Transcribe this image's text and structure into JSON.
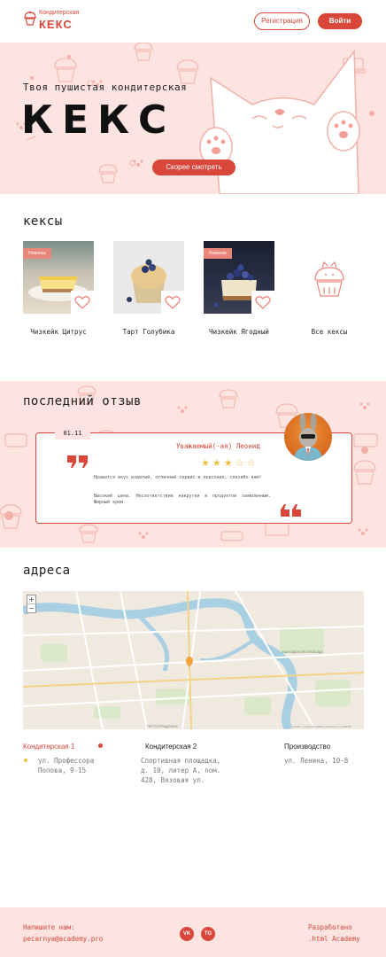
{
  "header": {
    "logo_small": "Кондитерская",
    "logo_big": "КЕКС",
    "register_label": "Регистрация",
    "login_label": "Войти"
  },
  "hero": {
    "subtitle": "Твоя пушистая кондитерская",
    "title": "КЕКС",
    "cta_label": "Скорее смотреть"
  },
  "cupcakes": {
    "title": "кексы",
    "items": [
      {
        "name": "Чизкейк Цитрус",
        "badge": "Новинка",
        "image": "lemon-cheesecake-slice"
      },
      {
        "name": "Тарт Голубика",
        "badge": "",
        "image": "blueberry-muffin"
      },
      {
        "name": "Чизкейк Ягодный",
        "badge": "Новинка",
        "image": "berry-cheesecake"
      }
    ],
    "all_label": "Все кексы"
  },
  "review": {
    "title": "последний отзыв",
    "date": "01.11",
    "author": "Уважаемый(-ая) Леонид",
    "rating": 3,
    "max_rating": 5,
    "paragraph_1": "Нравится вкус изделий, отличный сервис и персонал, спасибо вам!",
    "paragraph_2": "Высокий цена. Несоответствие накрутки и продуктов заявленным. Жирный крем."
  },
  "addresses": {
    "title": "адреса",
    "map_attribution": "Leaflet | © OpenStreetMap contributors © CARTO",
    "map_labels": {
      "district": "ВЫХОДСКОЙ СЛОБОДА",
      "street": "ПЕТРОГРАДСКАЯ"
    },
    "zoom_in": "+",
    "zoom_out": "−",
    "locations": [
      {
        "name": "Кондитерская 1",
        "address_line_1": "ул. Профессора",
        "address_line_2": "Попова, 9-15",
        "active": true
      },
      {
        "name": "Кондитерская 2",
        "address_line_1": "Спортивная площадка,",
        "address_line_2": "д. 10, литер А, пом.",
        "address_line_3": "428, Вязовая ул."
      },
      {
        "name": "Производство",
        "address_line_1": "ул. Ленина, 10-8"
      }
    ]
  },
  "footer": {
    "write_label": "Напишите нам:",
    "email": "pecarnya@academy.pro",
    "social": [
      {
        "icon": "vk-icon",
        "label": "VK"
      },
      {
        "icon": "telegram-icon",
        "label": "TG"
      }
    ],
    "dev_label": "Разработано",
    "dev_name": ".html Academy"
  },
  "colors": {
    "accent": "#d9463a",
    "pink_bg": "#fde4e1",
    "badge": "#e9867a",
    "star": "#f0c040"
  }
}
